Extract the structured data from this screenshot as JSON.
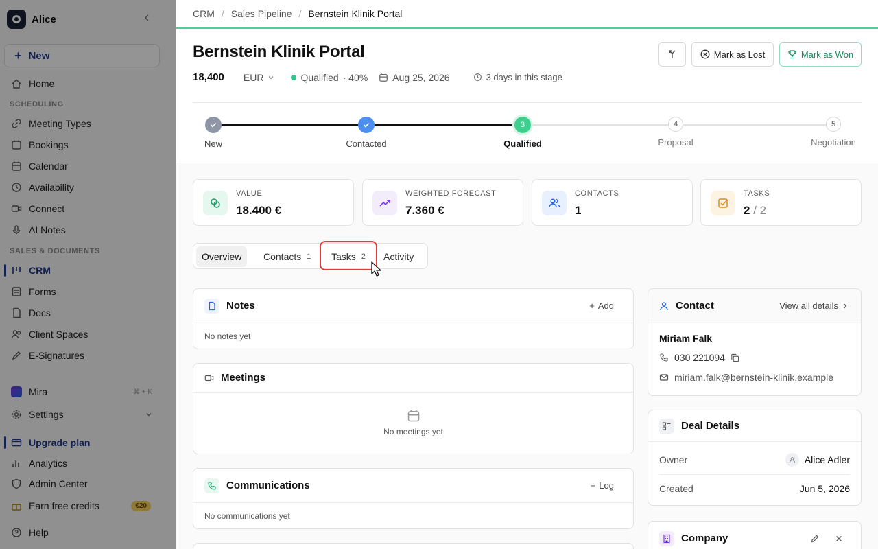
{
  "sidebar": {
    "workspace": "Alice",
    "new_label": "New",
    "sections": {
      "scheduling": "SCHEDULING",
      "sales": "SALES & DOCUMENTS"
    },
    "items": {
      "home": "Home",
      "meeting_types": "Meeting Types",
      "bookings": "Bookings",
      "calendar": "Calendar",
      "availability": "Availability",
      "connect": "Connect",
      "ai_notes": "AI Notes",
      "crm": "CRM",
      "forms": "Forms",
      "docs": "Docs",
      "client_spaces": "Client Spaces",
      "e_signatures": "E-Signatures",
      "mira": "Mira",
      "mira_shortcut": "⌘ + K",
      "settings": "Settings",
      "upgrade": "Upgrade plan",
      "analytics": "Analytics",
      "admin_center": "Admin Center",
      "earn_credits": "Earn free credits",
      "credits_badge": "€20",
      "help": "Help"
    }
  },
  "breadcrumb": {
    "root": "CRM",
    "pipeline": "Sales Pipeline",
    "current": "Bernstein Klinik Portal",
    "sep": "/"
  },
  "deal": {
    "title": "Bernstein Klinik Portal",
    "amount": "18,400",
    "currency": "EUR",
    "status": "Qualified",
    "probability": "· 40%",
    "close_date": "Aug 25, 2026",
    "stage_time": "3 days in this stage"
  },
  "actions": {
    "lost": "Mark as Lost",
    "won": "Mark as Won"
  },
  "stages": [
    {
      "num": "",
      "label": "New",
      "state": "done"
    },
    {
      "num": "",
      "label": "Contacted",
      "state": "done"
    },
    {
      "num": "3",
      "label": "Qualified",
      "state": "current"
    },
    {
      "num": "4",
      "label": "Proposal",
      "state": "pending"
    },
    {
      "num": "5",
      "label": "Negotiation",
      "state": "pending"
    }
  ],
  "stats": [
    {
      "label": "VALUE",
      "value": "18.400 €",
      "suffix": ""
    },
    {
      "label": "WEIGHTED FORECAST",
      "value": "7.360 €",
      "suffix": ""
    },
    {
      "label": "CONTACTS",
      "value": "1",
      "suffix": ""
    },
    {
      "label": "TASKS",
      "value": "2",
      "suffix": " / 2"
    }
  ],
  "tabs": [
    {
      "label": "Overview",
      "count": ""
    },
    {
      "label": "Contacts",
      "count": "1"
    },
    {
      "label": "Tasks",
      "count": "2"
    },
    {
      "label": "Activity",
      "count": ""
    }
  ],
  "notes": {
    "title": "Notes",
    "action": "Add",
    "empty": "No notes yet"
  },
  "meetings": {
    "title": "Meetings",
    "empty": "No meetings yet"
  },
  "communications": {
    "title": "Communications",
    "action": "Log",
    "empty": "No communications yet"
  },
  "contact": {
    "title": "Contact",
    "view_all": "View all details",
    "name": "Miriam Falk",
    "phone": "030 221094",
    "email": "miriam.falk@bernstein-klinik.example"
  },
  "deal_details": {
    "title": "Deal Details",
    "owner_label": "Owner",
    "owner": "Alice Adler",
    "created_label": "Created",
    "created": "Jun 5, 2026"
  },
  "company": {
    "title": "Company"
  },
  "colors": {
    "accent": "#1f3a8a",
    "success": "#34c38f",
    "highlight": "#e03b3b"
  }
}
